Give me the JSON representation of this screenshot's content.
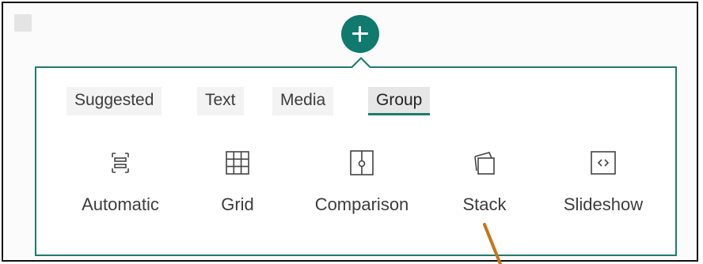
{
  "tabs": [
    {
      "label": "Suggested"
    },
    {
      "label": "Text"
    },
    {
      "label": "Media"
    },
    {
      "label": "Group",
      "active": true
    }
  ],
  "layouts": [
    {
      "label": "Automatic",
      "icon": "automatic-layout-icon"
    },
    {
      "label": "Grid",
      "icon": "grid-layout-icon"
    },
    {
      "label": "Comparison",
      "icon": "comparison-layout-icon"
    },
    {
      "label": "Stack",
      "icon": "stack-layout-icon"
    },
    {
      "label": "Slideshow",
      "icon": "slideshow-layout-icon"
    }
  ],
  "add_button": {
    "icon": "plus-icon"
  },
  "colors": {
    "accent": "#1e7b6e",
    "add_button": "#0f7a6d",
    "arrow_annotation": "#c8731a",
    "frame_border": "#111111"
  }
}
